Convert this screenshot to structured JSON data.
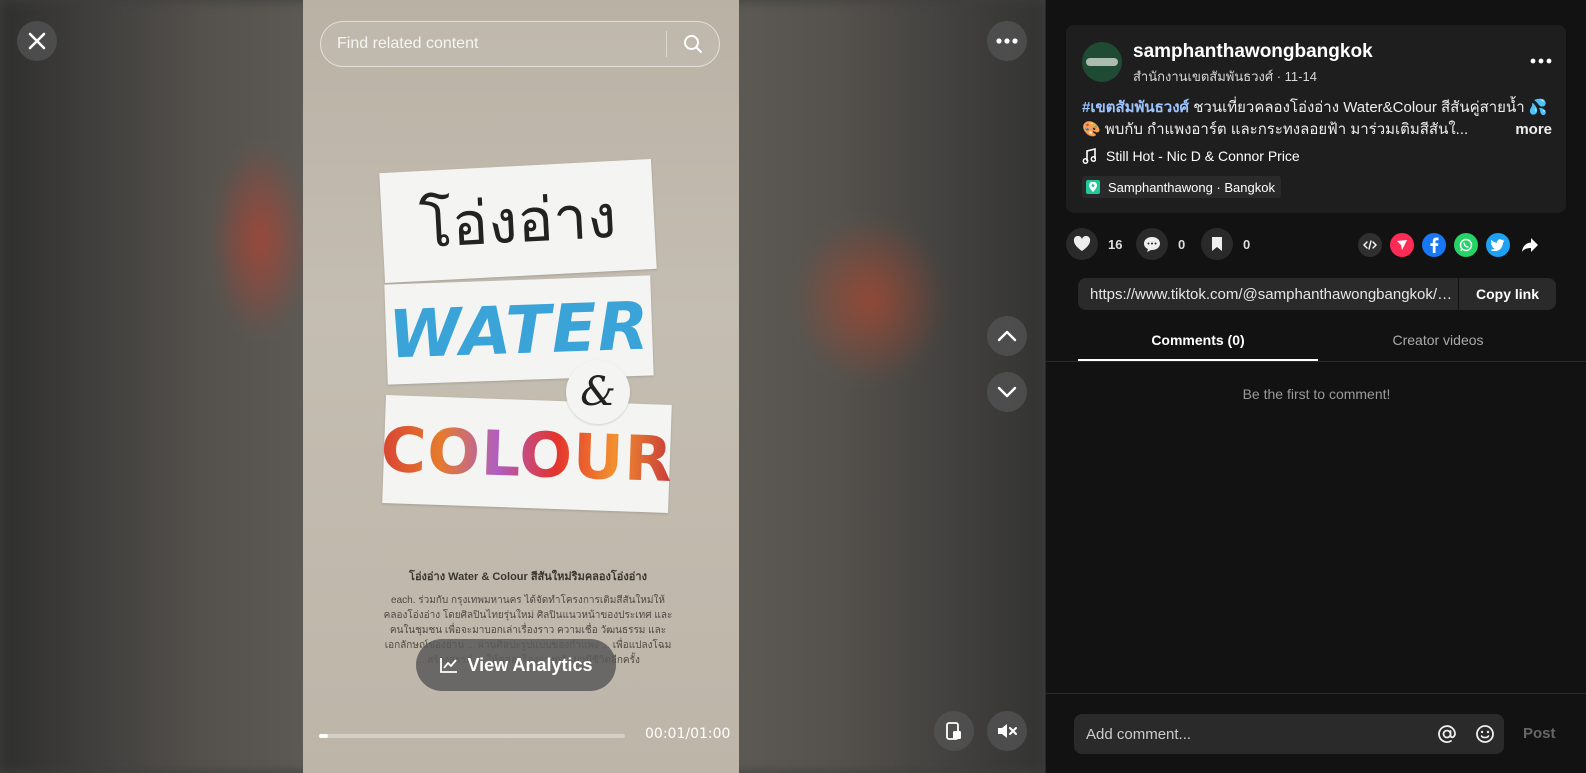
{
  "search": {
    "placeholder": "Find related content"
  },
  "video": {
    "poster_thai": "โอ่งอ่าง",
    "poster_water": "WATER",
    "poster_amp": "&",
    "poster_colour": "COLOUR",
    "desc_heading": "โอ่งอ่าง Water & Colour สีสันใหม่ริมคลองโอ่งอ่าง",
    "desc_body": "each. ร่วมกับ กรุงเทพมหานคร ได้จัดทำโครงการเติมสีสันใหม่ให้คลองโอ่งอ่าง โดยศิลปินไทยรุ่นใหม่ ศิลปินแนวหน้าของประเทศ และคนในชุมชน เพื่อจะมาบอกเล่าเรื่องราว ความเชื่อ วัฒนธรรม และเอกลักษณ์ของย่าน ... ผ่านศิลปะรูปแบบของกำแพง ... เพื่อแปลงโฉม ... สร้างสรรค์ ... ให้คลองโอ่งอ่างกลับมามีชีวิตอีกครั้ง",
    "analytics_label": "View Analytics",
    "time": "00:01/01:00",
    "progress": 0.03
  },
  "post": {
    "username": "samphanthawongbangkok",
    "subline": "สำนักงานเขตสัมพันธวงศ์ · 11-14",
    "hashtag": "#เขตสัมพันธวงศ์",
    "caption_text": " ชวนเที่ยวคลองโอ่งอ่าง Water&Colour สีสันคู่สายน้ำ 💦 🎨 พบกับ กำแพงอาร์ต และกระทงลอยฟ้า มาร่วมเติมสีสันใ...",
    "more_label": "more",
    "music": "Still Hot - Nic D & Connor Price",
    "location": "Samphanthawong · Bangkok"
  },
  "actions": {
    "likes": "16",
    "comments": "0",
    "saves": "0"
  },
  "share_colors": {
    "embed": "#2f2f2f",
    "send": "#fe2c55",
    "facebook": "#1877f2",
    "whatsapp": "#25d366",
    "twitter": "#1da1f2"
  },
  "link": {
    "url": "https://www.tiktok.com/@samphanthawongbangkok/vi...",
    "copy_label": "Copy link"
  },
  "tabs": {
    "comments": "Comments (0)",
    "creator": "Creator videos"
  },
  "comments": {
    "empty": "Be the first to comment!",
    "placeholder": "Add comment...",
    "post_label": "Post"
  }
}
